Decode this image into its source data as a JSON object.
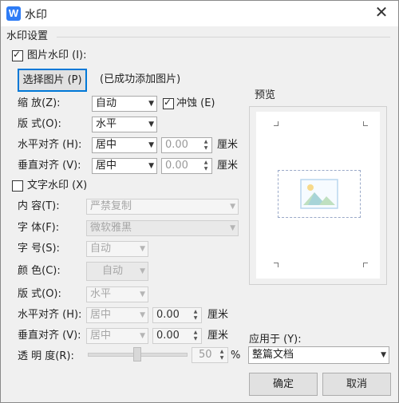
{
  "title": "水印",
  "app_icon_letter": "W",
  "section_title": "水印设置",
  "picture": {
    "checkbox_label": "图片水印 (I):",
    "checked": true,
    "select_button": "选择图片 (P)",
    "status": "(已成功添加图片)",
    "scale_label": "缩 放(Z):",
    "scale_value": "自动",
    "washout_label": "冲蚀 (E)",
    "washout_checked": true,
    "layout_label": "版 式(O):",
    "layout_value": "水平",
    "halign_label": "水平对齐 (H):",
    "halign_value": "居中",
    "halign_offset": "0.00",
    "valign_label": "垂直对齐 (V):",
    "valign_value": "居中",
    "valign_offset": "0.00",
    "unit": "厘米"
  },
  "text": {
    "checkbox_label": "文字水印 (X)",
    "checked": false,
    "content_label": "内 容(T):",
    "content_value": "严禁复制",
    "font_label": "字 体(F):",
    "font_value": "微软雅黑",
    "size_label": "字 号(S):",
    "size_value": "自动",
    "color_label": "颜 色(C):",
    "color_value": "自动",
    "layout_label": "版 式(O):",
    "layout_value": "水平",
    "halign_label": "水平对齐 (H):",
    "halign_value": "居中",
    "halign_offset": "0.00",
    "valign_label": "垂直对齐 (V):",
    "valign_value": "居中",
    "valign_offset": "0.00",
    "unit": "厘米",
    "transparency_label": "透 明 度(R):",
    "transparency_value": "50",
    "transparency_unit": "%"
  },
  "preview_label": "预览",
  "apply_label": "应用于 (Y):",
  "apply_value": "整篇文档",
  "ok_button": "确定",
  "cancel_button": "取消",
  "colors": {
    "accent": "#0078d7",
    "app_icon": "#2e7cf6"
  }
}
